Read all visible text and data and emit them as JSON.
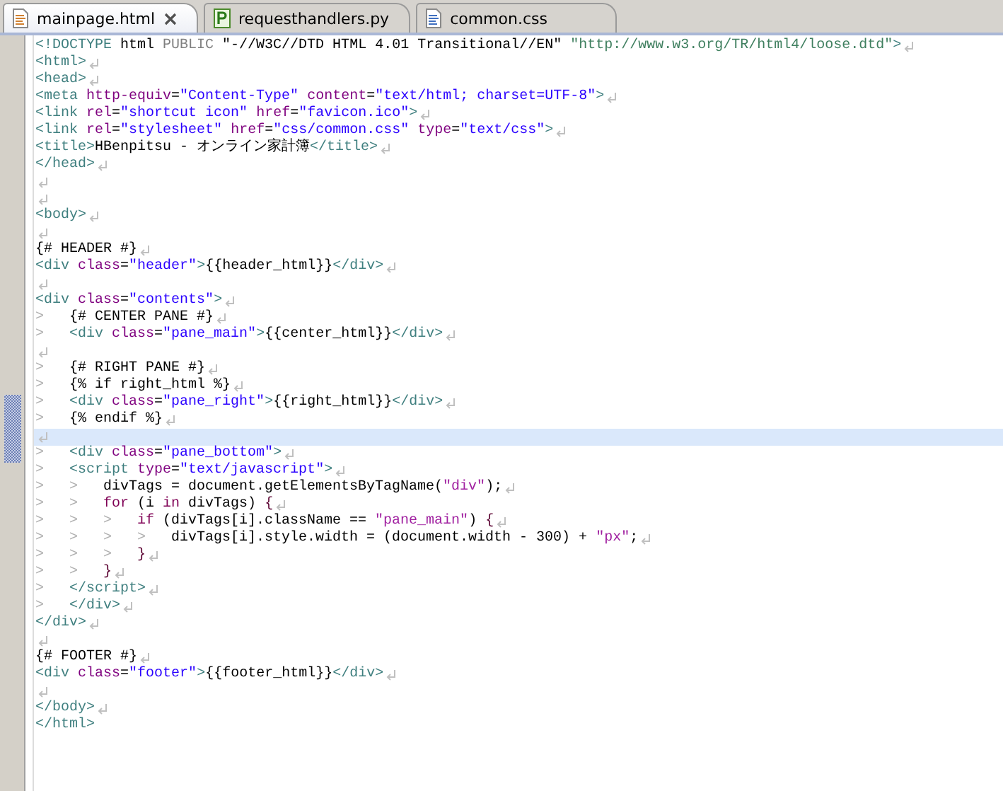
{
  "tabs": [
    {
      "label": "mainpage.html",
      "kind": "html",
      "selected": true
    },
    {
      "label": "requesthandlers.py",
      "kind": "python",
      "selected": false
    },
    {
      "label": "common.css",
      "kind": "css",
      "selected": false
    }
  ],
  "lines": [
    {
      "tokens": [
        {
          "kind": "tag",
          "text": "<!DOCTYPE"
        },
        {
          "kind": "text",
          "text": " html "
        },
        {
          "kind": "doctype",
          "text": "PUBLIC"
        },
        {
          "kind": "text",
          "text": " \"-//W3C//DTD HTML 4.01 Transitional//EN\" "
        },
        {
          "kind": "uri",
          "text": "\"http://www.w3.org/TR/html4/loose.dtd\""
        },
        {
          "kind": "tag",
          "text": ">"
        }
      ],
      "eol": true,
      "current": false,
      "changed": false
    },
    {
      "tokens": [
        {
          "kind": "tag",
          "text": "<html>"
        }
      ],
      "eol": true,
      "current": false,
      "changed": false
    },
    {
      "tokens": [
        {
          "kind": "tag",
          "text": "<head>"
        }
      ],
      "eol": true,
      "current": false,
      "changed": false
    },
    {
      "tokens": [
        {
          "kind": "tag",
          "text": "<meta"
        },
        {
          "kind": "attr",
          "text": " http-equiv"
        },
        {
          "kind": "text",
          "text": "="
        },
        {
          "kind": "value",
          "text": "\"Content-Type\""
        },
        {
          "kind": "attr",
          "text": " content"
        },
        {
          "kind": "text",
          "text": "="
        },
        {
          "kind": "value",
          "text": "\"text/html; charset=UTF-8\""
        },
        {
          "kind": "tag",
          "text": ">"
        }
      ],
      "eol": true,
      "current": false,
      "changed": false
    },
    {
      "tokens": [
        {
          "kind": "tag",
          "text": "<link"
        },
        {
          "kind": "attr",
          "text": " rel"
        },
        {
          "kind": "text",
          "text": "="
        },
        {
          "kind": "value",
          "text": "\"shortcut icon\""
        },
        {
          "kind": "attr",
          "text": " href"
        },
        {
          "kind": "text",
          "text": "="
        },
        {
          "kind": "value",
          "text": "\"favicon.ico\""
        },
        {
          "kind": "tag",
          "text": ">"
        }
      ],
      "eol": true,
      "current": false,
      "changed": false
    },
    {
      "tokens": [
        {
          "kind": "tag",
          "text": "<link"
        },
        {
          "kind": "attr",
          "text": " rel"
        },
        {
          "kind": "text",
          "text": "="
        },
        {
          "kind": "value",
          "text": "\"stylesheet\""
        },
        {
          "kind": "attr",
          "text": " href"
        },
        {
          "kind": "text",
          "text": "="
        },
        {
          "kind": "value",
          "text": "\"css/common.css\""
        },
        {
          "kind": "attr",
          "text": " type"
        },
        {
          "kind": "text",
          "text": "="
        },
        {
          "kind": "value",
          "text": "\"text/css\""
        },
        {
          "kind": "tag",
          "text": ">"
        }
      ],
      "eol": true,
      "current": false,
      "changed": false
    },
    {
      "tokens": [
        {
          "kind": "tag",
          "text": "<title>"
        },
        {
          "kind": "text",
          "text": "HBenpitsu - オンライン家計簿"
        },
        {
          "kind": "tag",
          "text": "</title>"
        }
      ],
      "eol": true,
      "current": false,
      "changed": false
    },
    {
      "tokens": [
        {
          "kind": "tag",
          "text": "</head>"
        }
      ],
      "eol": true,
      "current": false,
      "changed": false
    },
    {
      "eol": true,
      "current": false,
      "changed": false
    },
    {
      "eol": true,
      "current": false,
      "changed": false
    },
    {
      "tokens": [
        {
          "kind": "tag",
          "text": "<body>"
        }
      ],
      "eol": true,
      "current": false,
      "changed": false
    },
    {
      "eol": true,
      "current": false,
      "changed": false
    },
    {
      "tokens": [
        {
          "kind": "text",
          "text": "{# HEADER #}"
        }
      ],
      "eol": true,
      "current": false,
      "changed": false
    },
    {
      "tokens": [
        {
          "kind": "tag",
          "text": "<div"
        },
        {
          "kind": "attr",
          "text": " class"
        },
        {
          "kind": "text",
          "text": "="
        },
        {
          "kind": "value",
          "text": "\"header\""
        },
        {
          "kind": "tag",
          "text": ">"
        },
        {
          "kind": "text",
          "text": "{{header_html}}"
        },
        {
          "kind": "tag",
          "text": "</div>"
        }
      ],
      "eol": true,
      "current": false,
      "changed": false
    },
    {
      "eol": true,
      "current": false,
      "changed": false
    },
    {
      "tokens": [
        {
          "kind": "tag",
          "text": "<div"
        },
        {
          "kind": "attr",
          "text": " class"
        },
        {
          "kind": "text",
          "text": "="
        },
        {
          "kind": "value",
          "text": "\"contents\""
        },
        {
          "kind": "tag",
          "text": ">"
        }
      ],
      "eol": true,
      "current": false,
      "changed": false
    },
    {
      "indent": [
        ">"
      ],
      "tokens": [
        {
          "kind": "text",
          "text": "{# CENTER PANE #}"
        }
      ],
      "eol": true,
      "current": false,
      "changed": false
    },
    {
      "indent": [
        ">"
      ],
      "tokens": [
        {
          "kind": "tag",
          "text": "<div"
        },
        {
          "kind": "attr",
          "text": " class"
        },
        {
          "kind": "text",
          "text": "="
        },
        {
          "kind": "value",
          "text": "\"pane_main\""
        },
        {
          "kind": "tag",
          "text": ">"
        },
        {
          "kind": "text",
          "text": "{{center_html}}"
        },
        {
          "kind": "tag",
          "text": "</div>"
        }
      ],
      "eol": true,
      "current": false,
      "changed": false
    },
    {
      "eol": true,
      "current": false,
      "changed": false
    },
    {
      "indent": [
        ">"
      ],
      "tokens": [
        {
          "kind": "text",
          "text": "{# RIGHT PANE #}"
        }
      ],
      "eol": true,
      "current": false,
      "changed": false
    },
    {
      "indent": [
        ">"
      ],
      "tokens": [
        {
          "kind": "text",
          "text": "{% if right_html %}"
        }
      ],
      "eol": true,
      "current": false,
      "changed": false
    },
    {
      "indent": [
        ">"
      ],
      "tokens": [
        {
          "kind": "tag",
          "text": "<div"
        },
        {
          "kind": "attr",
          "text": " class"
        },
        {
          "kind": "text",
          "text": "="
        },
        {
          "kind": "value",
          "text": "\"pane_right\""
        },
        {
          "kind": "tag",
          "text": ">"
        },
        {
          "kind": "text",
          "text": "{{right_html}}"
        },
        {
          "kind": "tag",
          "text": "</div>"
        }
      ],
      "eol": true,
      "current": false,
      "changed": true
    },
    {
      "indent": [
        ">"
      ],
      "tokens": [
        {
          "kind": "text",
          "text": "{% endif %}"
        }
      ],
      "eol": true,
      "current": false,
      "changed": true
    },
    {
      "eol": true,
      "current": true,
      "changed": true
    },
    {
      "indent": [
        ">"
      ],
      "tokens": [
        {
          "kind": "tag",
          "text": "<div"
        },
        {
          "kind": "attr",
          "text": " class"
        },
        {
          "kind": "text",
          "text": "="
        },
        {
          "kind": "value",
          "text": "\"pane_bottom\""
        },
        {
          "kind": "tag",
          "text": ">"
        }
      ],
      "eol": true,
      "current": false,
      "changed": true
    },
    {
      "indent": [
        ">"
      ],
      "tokens": [
        {
          "kind": "tag",
          "text": "<script"
        },
        {
          "kind": "attr",
          "text": " type"
        },
        {
          "kind": "text",
          "text": "="
        },
        {
          "kind": "value",
          "text": "\"text/javascript\""
        },
        {
          "kind": "tag",
          "text": ">"
        }
      ],
      "eol": true,
      "current": false,
      "changed": false
    },
    {
      "indent": [
        ">",
        ">"
      ],
      "tokens": [
        {
          "kind": "text",
          "text": "divTags = document.getElementsByTagName("
        },
        {
          "kind": "string",
          "text": "\"div\""
        },
        {
          "kind": "text",
          "text": ");"
        }
      ],
      "eol": true,
      "current": false,
      "changed": false
    },
    {
      "indent": [
        ">",
        ">"
      ],
      "tokens": [
        {
          "kind": "keyword",
          "text": "for"
        },
        {
          "kind": "text",
          "text": " (i "
        },
        {
          "kind": "keyword",
          "text": "in"
        },
        {
          "kind": "text",
          "text": " divTags) "
        },
        {
          "kind": "brace",
          "text": "{"
        }
      ],
      "eol": true,
      "current": false,
      "changed": false
    },
    {
      "indent": [
        ">",
        ">",
        ">"
      ],
      "tokens": [
        {
          "kind": "keyword",
          "text": "if"
        },
        {
          "kind": "text",
          "text": " (divTags[i].className == "
        },
        {
          "kind": "string",
          "text": "\"pane_main\""
        },
        {
          "kind": "text",
          "text": ") "
        },
        {
          "kind": "brace",
          "text": "{"
        }
      ],
      "eol": true,
      "current": false,
      "changed": false
    },
    {
      "indent": [
        ">",
        ">",
        ">",
        ">"
      ],
      "tokens": [
        {
          "kind": "text",
          "text": "divTags[i].style.width = (document.width - 300) + "
        },
        {
          "kind": "string",
          "text": "\"px\""
        },
        {
          "kind": "text",
          "text": ";"
        }
      ],
      "eol": true,
      "current": false,
      "changed": false
    },
    {
      "indent": [
        ">",
        ">",
        ">"
      ],
      "tokens": [
        {
          "kind": "brace",
          "text": "}"
        }
      ],
      "eol": true,
      "current": false,
      "changed": false
    },
    {
      "indent": [
        ">",
        ">"
      ],
      "tokens": [
        {
          "kind": "brace",
          "text": "}"
        }
      ],
      "eol": true,
      "current": false,
      "changed": false
    },
    {
      "indent": [
        ">"
      ],
      "tokens": [
        {
          "kind": "tag",
          "text": "</script>"
        }
      ],
      "eol": true,
      "current": false,
      "changed": false
    },
    {
      "indent": [
        ">"
      ],
      "tokens": [
        {
          "kind": "tag",
          "text": "</div>"
        }
      ],
      "eol": true,
      "current": false,
      "changed": false
    },
    {
      "tokens": [
        {
          "kind": "tag",
          "text": "</div>"
        }
      ],
      "eol": true,
      "current": false,
      "changed": false
    },
    {
      "eol": true,
      "current": false,
      "changed": false
    },
    {
      "tokens": [
        {
          "kind": "text",
          "text": "{# FOOTER #}"
        }
      ],
      "eol": true,
      "current": false,
      "changed": false
    },
    {
      "tokens": [
        {
          "kind": "tag",
          "text": "<div"
        },
        {
          "kind": "attr",
          "text": " class"
        },
        {
          "kind": "text",
          "text": "="
        },
        {
          "kind": "value",
          "text": "\"footer\""
        },
        {
          "kind": "tag",
          "text": ">"
        },
        {
          "kind": "text",
          "text": "{{footer_html}}"
        },
        {
          "kind": "tag",
          "text": "</div>"
        }
      ],
      "eol": true,
      "current": false,
      "changed": false
    },
    {
      "eol": true,
      "current": false,
      "changed": false
    },
    {
      "tokens": [
        {
          "kind": "tag",
          "text": "</body>"
        }
      ],
      "eol": true,
      "current": false,
      "changed": false
    },
    {
      "tokens": [
        {
          "kind": "tag",
          "text": "</html>"
        }
      ],
      "eol": false,
      "current": false,
      "changed": false
    }
  ]
}
